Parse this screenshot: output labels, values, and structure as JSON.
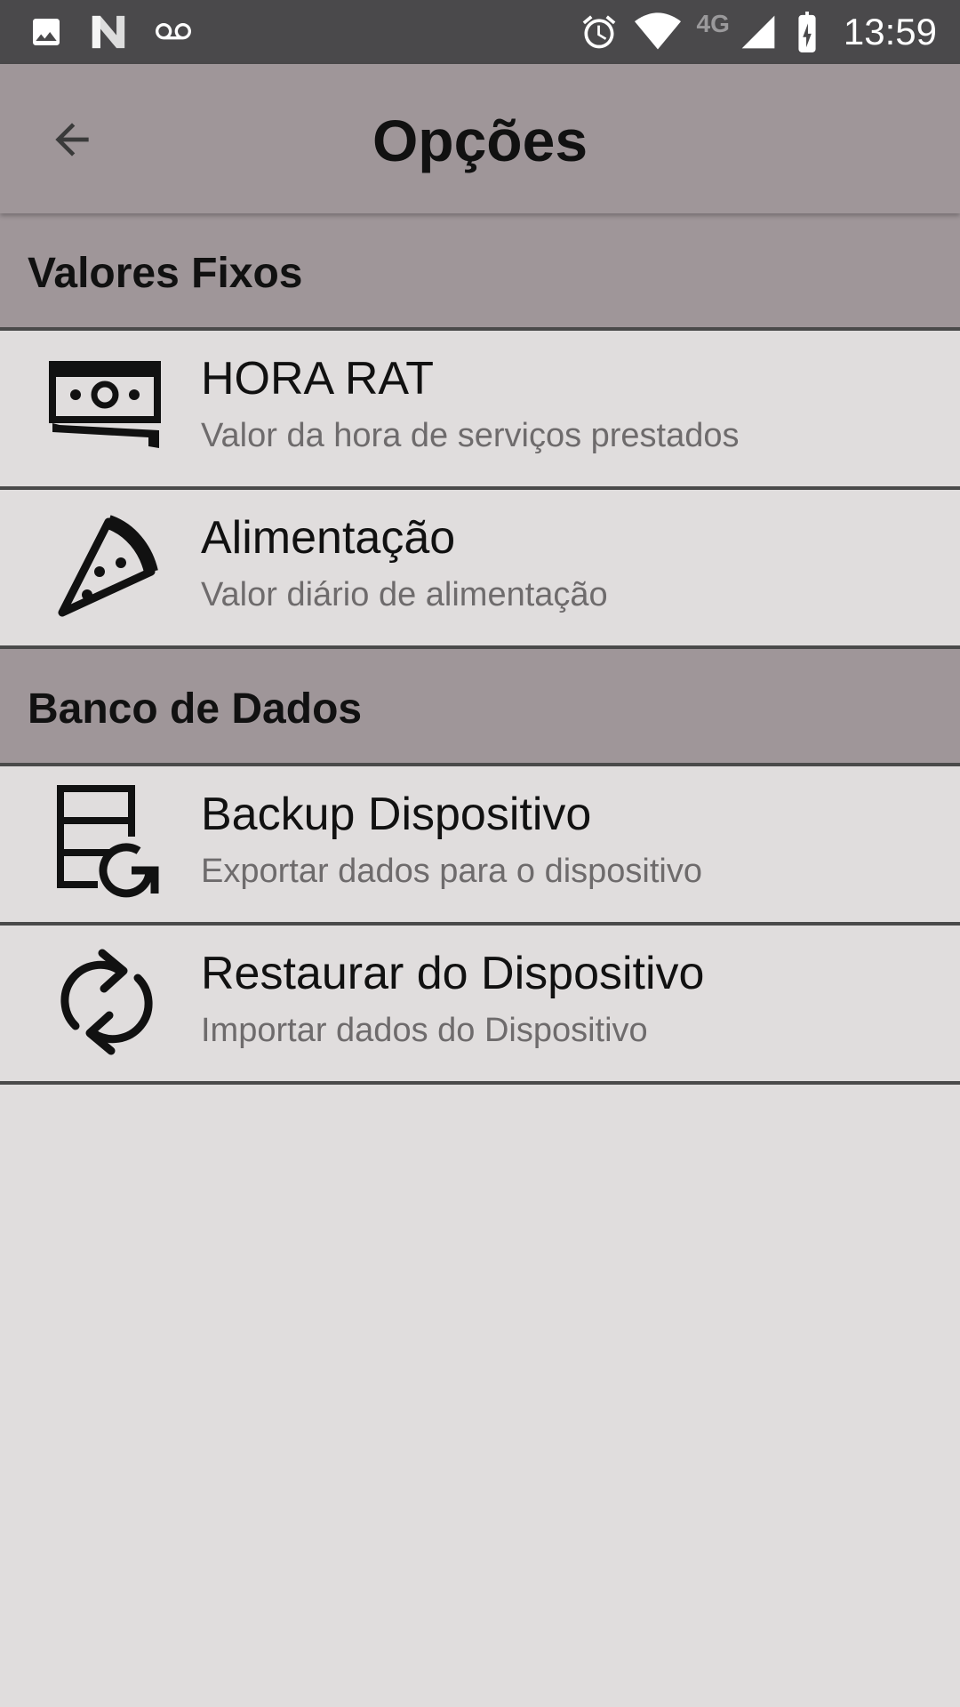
{
  "status_bar": {
    "left_icons": [
      "image-icon",
      "n-logo-icon",
      "voicemail-icon"
    ],
    "right_icons": [
      "alarm-icon",
      "wifi-icon",
      "signal-icon",
      "battery-charging-icon"
    ],
    "network": "4G",
    "time": "13:59"
  },
  "app_bar": {
    "back_icon": "arrow-back-icon",
    "title": "Opções"
  },
  "sections": [
    {
      "header": "Valores Fixos",
      "items": [
        {
          "icon": "money-icon",
          "title": "HORA RAT",
          "subtitle": "Valor da hora de serviços prestados"
        },
        {
          "icon": "pizza-icon",
          "title": "Alimentação",
          "subtitle": "Valor diário de alimentação"
        }
      ]
    },
    {
      "header": "Banco de Dados",
      "items": [
        {
          "icon": "database-backup-icon",
          "title": "Backup Dispositivo",
          "subtitle": "Exportar dados para o dispositivo"
        },
        {
          "icon": "sync-icon",
          "title": "Restaurar do Dispositivo",
          "subtitle": "Importar dados do Dispositivo"
        }
      ]
    }
  ],
  "colors": {
    "status_bar": "#4a494b",
    "app_bar": "#9f9699",
    "background": "#e0dddd",
    "divider": "#4a4a4a"
  }
}
